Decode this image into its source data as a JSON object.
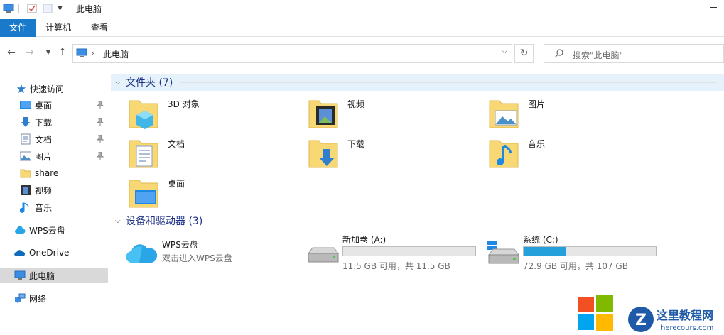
{
  "window": {
    "title": "此电脑"
  },
  "ribbon": {
    "tabs": [
      "文件",
      "计算机",
      "查看"
    ]
  },
  "address": {
    "path": "此电脑",
    "search_placeholder": "搜索\"此电脑\""
  },
  "sidebar": {
    "quick_access": "快速访问",
    "items": [
      {
        "label": "桌面",
        "icon": "desktop-icon",
        "pinned": true
      },
      {
        "label": "下载",
        "icon": "download-icon",
        "pinned": true
      },
      {
        "label": "文档",
        "icon": "document-icon",
        "pinned": true
      },
      {
        "label": "图片",
        "icon": "picture-icon",
        "pinned": true
      },
      {
        "label": "share",
        "icon": "folder-icon",
        "pinned": false
      },
      {
        "label": "视频",
        "icon": "video-icon",
        "pinned": false
      },
      {
        "label": "音乐",
        "icon": "music-icon",
        "pinned": false
      }
    ],
    "wps": "WPS云盘",
    "onedrive": "OneDrive",
    "this_pc": "此电脑",
    "network": "网络"
  },
  "folders_group": {
    "title": "文件夹 (7)",
    "items": [
      "3D 对象",
      "视频",
      "图片",
      "文档",
      "下载",
      "音乐",
      "桌面"
    ]
  },
  "devices_group": {
    "title": "设备和驱动器 (3)",
    "wps": {
      "name": "WPS云盘",
      "subtitle": "双击进入WPS云盘"
    },
    "drives": [
      {
        "name": "新加卷 (A:)",
        "free": "11.5 GB 可用，共 11.5 GB",
        "used_fraction": 0.0
      },
      {
        "name": "系统 (C:)",
        "free": "72.9 GB 可用，共 107 GB",
        "used_fraction": 0.32
      }
    ]
  },
  "colors": {
    "accent": "#1979ca",
    "selected": "#d9d9d9",
    "drive_bar": "#26a0da",
    "folder": "#f8d775"
  }
}
